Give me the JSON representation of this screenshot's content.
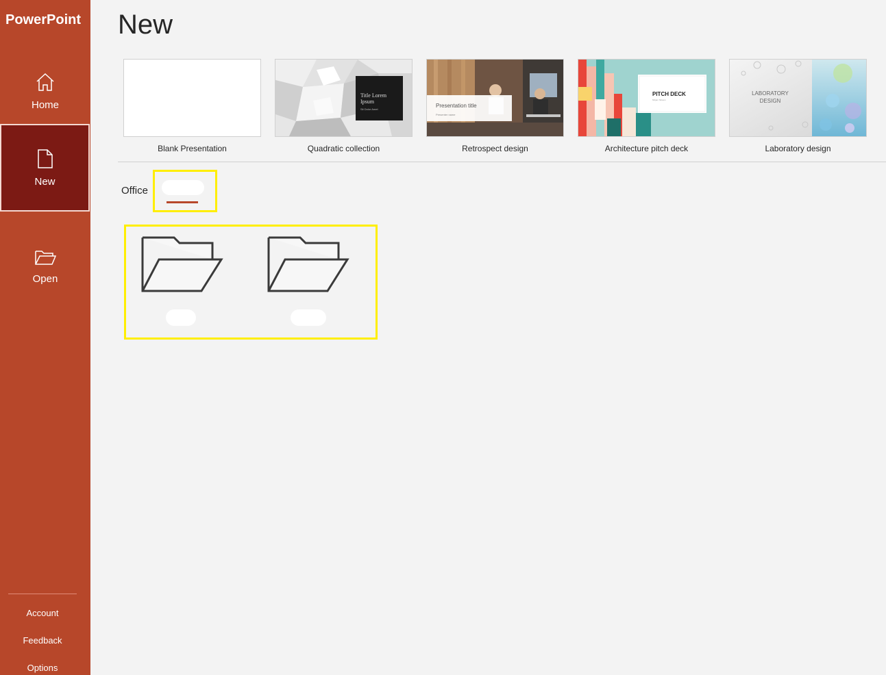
{
  "app": {
    "title": "PowerPoint"
  },
  "sidebar": {
    "items": [
      {
        "label": "Home",
        "icon": "home-icon"
      },
      {
        "label": "New",
        "icon": "new-document-icon"
      },
      {
        "label": "Open",
        "icon": "open-folder-icon"
      }
    ],
    "footer": [
      {
        "label": "Account"
      },
      {
        "label": "Feedback"
      },
      {
        "label": "Options"
      }
    ]
  },
  "main": {
    "title": "New",
    "templates": [
      {
        "label": "Blank Presentation"
      },
      {
        "label": "Quadratic collection",
        "thumb_title": "Title Lorem Ipsum",
        "thumb_sub": "Sit Dolor Amet"
      },
      {
        "label": "Retrospect design",
        "thumb_title": "Presentation title",
        "thumb_sub": "Presenter name"
      },
      {
        "label": "Architecture pitch deck",
        "thumb_title": "PITCH DECK",
        "thumb_sub": "Mirjam Nilsson"
      },
      {
        "label": "Laboratory design",
        "thumb_title": "LABORATORY DESIGN"
      }
    ],
    "tabs": [
      {
        "label": "Office"
      }
    ]
  },
  "colors": {
    "brand": "#b7472a",
    "active_nav": "#7c1a14",
    "highlight": "#ffee00",
    "background": "#f3f3f3"
  }
}
